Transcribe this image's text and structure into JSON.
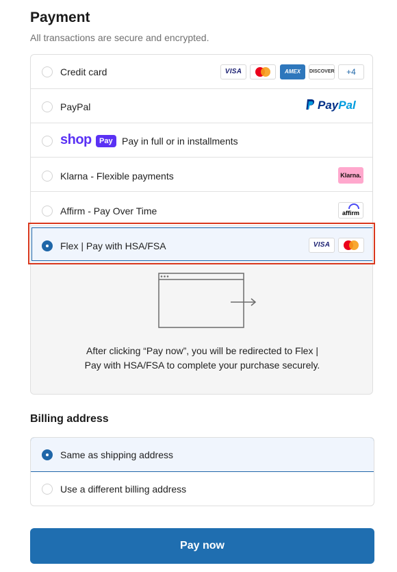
{
  "payment": {
    "title": "Payment",
    "subtitle": "All transactions are secure and encrypted.",
    "methods": [
      {
        "label": "Credit card",
        "selected": false,
        "badges": [
          "VISA",
          "mastercard",
          "AMEX",
          "DISCOVER",
          "+4"
        ]
      },
      {
        "label": "PayPal",
        "selected": false,
        "logo_text_1": "Pay",
        "logo_text_2": "Pal"
      },
      {
        "label": "Pay in full or in installments",
        "selected": false,
        "logo_text_1": "shop",
        "logo_text_2": "Pay"
      },
      {
        "label": "Klarna - Flexible payments",
        "selected": false,
        "logo_text": "Klarna."
      },
      {
        "label": "Affirm - Pay Over Time",
        "selected": false,
        "logo_text": "affirm"
      },
      {
        "label": "Flex | Pay with HSA/FSA",
        "selected": true,
        "badges": [
          "VISA",
          "mastercard"
        ]
      }
    ],
    "redirect_text": "After clicking “Pay now”, you will be redirected to Flex | Pay with HSA/FSA to complete your purchase securely."
  },
  "billing": {
    "title": "Billing address",
    "options": [
      {
        "label": "Same as shipping address",
        "selected": true
      },
      {
        "label": "Use a different billing address",
        "selected": false
      }
    ]
  },
  "pay_button": {
    "label": "Pay now"
  },
  "colors": {
    "accent": "#1f6eb0",
    "selected_bg": "#f0f5fd",
    "highlight_outline": "#d9371d"
  }
}
